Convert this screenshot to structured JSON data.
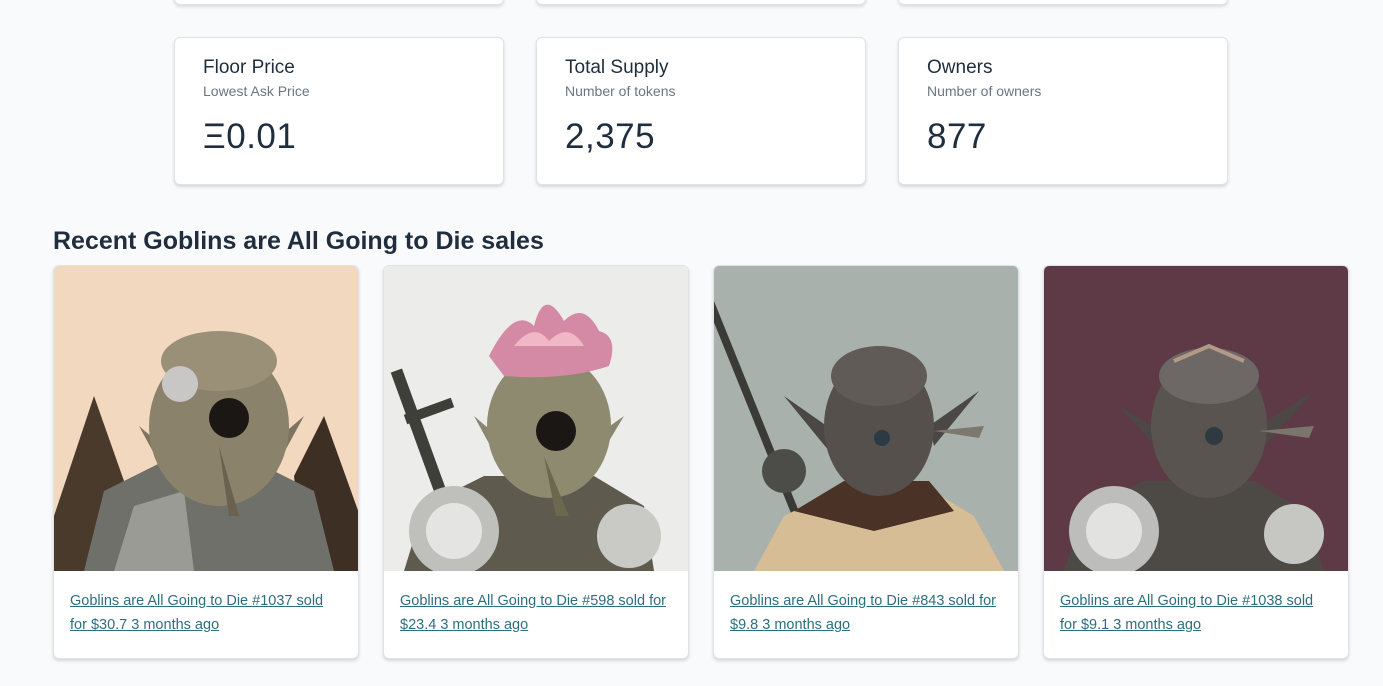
{
  "stats": [
    {
      "title": "Floor Price",
      "subtitle": "Lowest Ask Price",
      "value": "Ξ0.01"
    },
    {
      "title": "Total Supply",
      "subtitle": "Number of tokens",
      "value": "2,375"
    },
    {
      "title": "Owners",
      "subtitle": "Number of owners",
      "value": "877"
    }
  ],
  "recent_sales": {
    "heading": "Recent Goblins are All Going to Die sales",
    "items": [
      {
        "label": "Goblins are All Going to Die #1037 sold for $30.7 3 months ago",
        "bg": "#f3d8c0"
      },
      {
        "label": "Goblins are All Going to Die #598 sold for $23.4 3 months ago",
        "bg": "#ececea"
      },
      {
        "label": "Goblins are All Going to Die #843 sold for $9.8 3 months ago",
        "bg": "#a8b1ab"
      },
      {
        "label": "Goblins are All Going to Die #1038 sold for $9.1 3 months ago",
        "bg": "#5e3a46"
      }
    ]
  }
}
